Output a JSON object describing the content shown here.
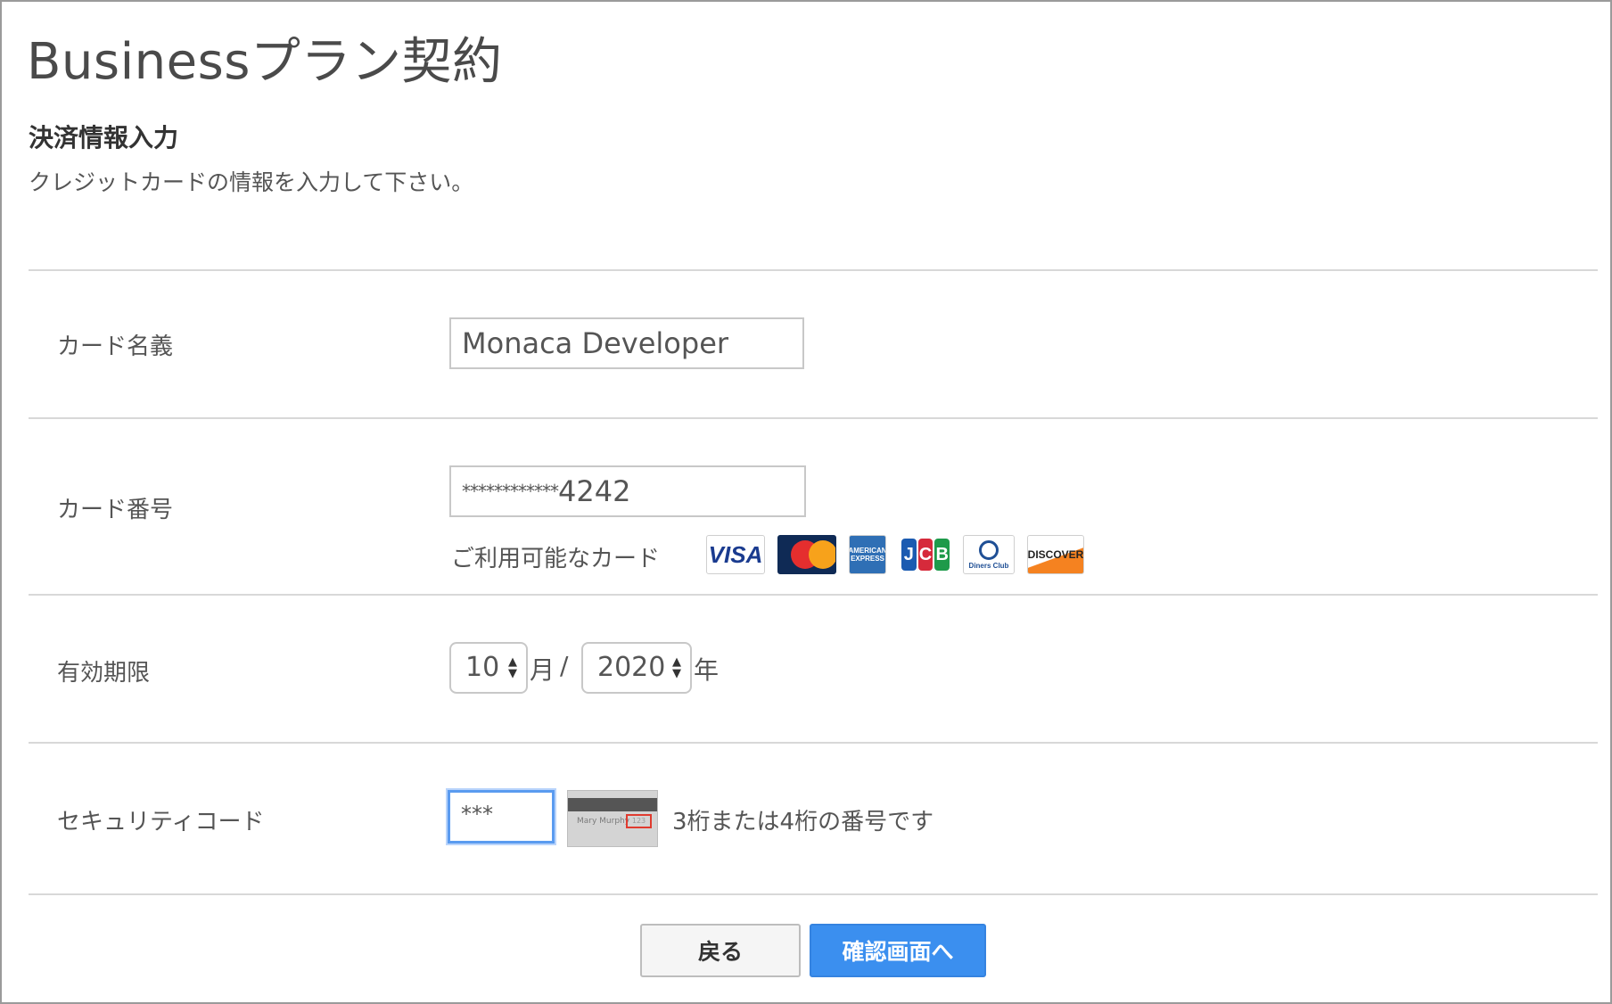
{
  "page": {
    "title": "Businessプラン契約",
    "section_heading": "決済情報入力",
    "section_description": "クレジットカードの情報を入力して下さい。"
  },
  "form": {
    "card_holder": {
      "label": "カード名義",
      "value": "Monaca Developer"
    },
    "card_number": {
      "label": "カード番号",
      "masked_part": "************",
      "last_digits": "4242",
      "available_cards_label": "ご利用可能なカード",
      "available_cards": [
        "VISA",
        "MasterCard",
        "AMERICAN EXPRESS",
        "JCB",
        "Diners Club",
        "DISCOVER"
      ]
    },
    "expiry": {
      "label": "有効期限",
      "month_value": "10",
      "month_unit": "月",
      "separator": "/",
      "year_value": "2020",
      "year_unit": "年"
    },
    "security_code": {
      "label": "セキュリティコード",
      "value": "***",
      "card_sample_name": "Mary Murphy",
      "card_sample_code": "123",
      "hint": "3桁または4桁の番号です"
    }
  },
  "buttons": {
    "back_label": "戻る",
    "next_label": "確認画面へ"
  },
  "colors": {
    "primary_button": "#3b8fef",
    "focus_ring": "#5a9bf0",
    "cvv_highlight": "#e03b2f"
  }
}
